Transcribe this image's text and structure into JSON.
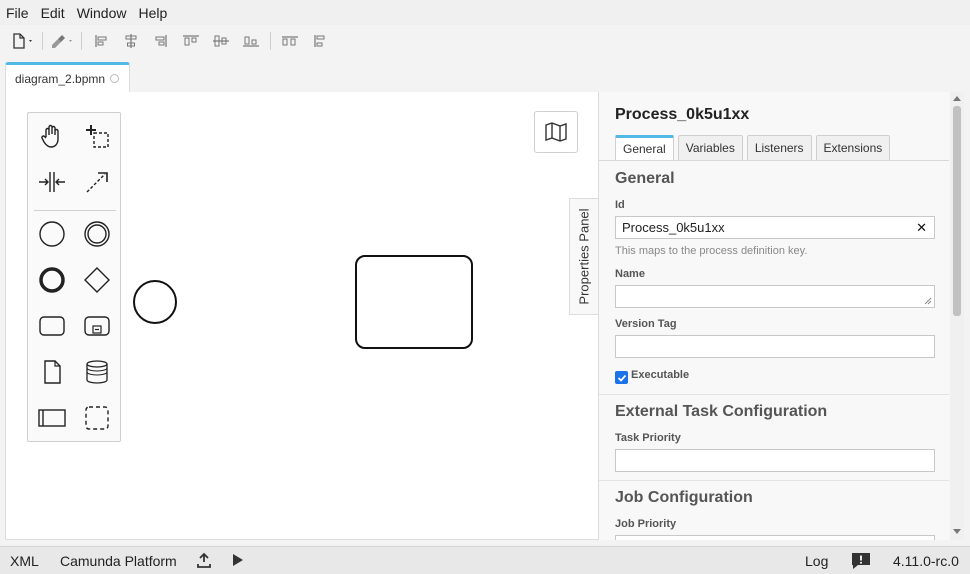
{
  "menu": {
    "items": [
      "File",
      "Edit",
      "Window",
      "Help"
    ]
  },
  "tab": {
    "name": "diagram_2.bpmn"
  },
  "properties_panel": {
    "toggle_label": "Properties Panel",
    "title": "Process_0k5u1xx",
    "tabs": [
      "General",
      "Variables",
      "Listeners",
      "Extensions"
    ],
    "general": {
      "heading": "General",
      "id_label": "Id",
      "id_value": "Process_0k5u1xx",
      "id_hint": "This maps to the process definition key.",
      "name_label": "Name",
      "name_value": "",
      "version_tag_label": "Version Tag",
      "version_tag_value": "",
      "executable_label": "Executable",
      "executable_checked": true
    },
    "external_task": {
      "heading": "External Task Configuration",
      "task_priority_label": "Task Priority",
      "task_priority_value": ""
    },
    "job": {
      "heading": "Job Configuration",
      "job_priority_label": "Job Priority"
    }
  },
  "statusbar": {
    "xml": "XML",
    "platform": "Camunda Platform",
    "log": "Log",
    "version": "4.11.0-rc.0"
  },
  "colors": {
    "accent": "#52b8e6",
    "checkbox": "#1a73e8"
  }
}
